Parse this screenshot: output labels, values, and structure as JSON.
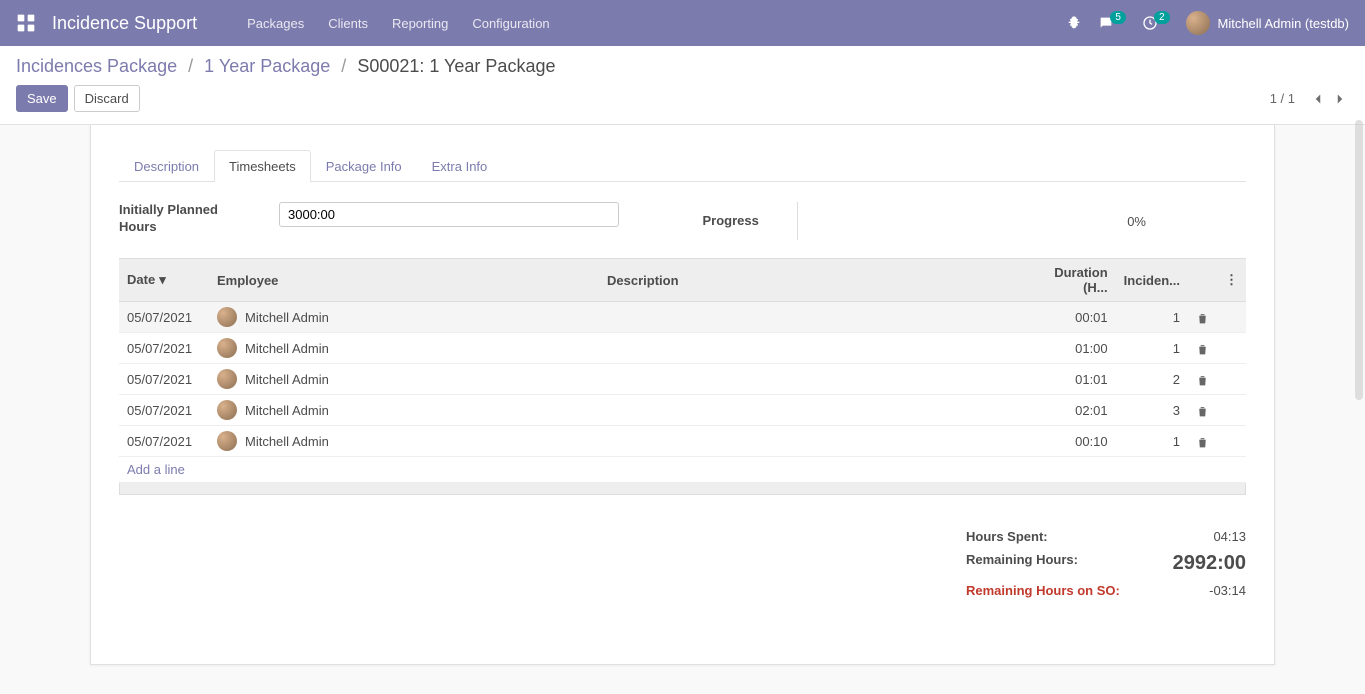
{
  "navbar": {
    "brand": "Incidence Support",
    "menu": [
      "Packages",
      "Clients",
      "Reporting",
      "Configuration"
    ],
    "messages_badge": "5",
    "activities_badge": "2",
    "user_name": "Mitchell Admin (testdb)"
  },
  "breadcrumb": {
    "items": [
      "Incidences Package",
      "1 Year Package"
    ],
    "current": "S00021: 1 Year Package"
  },
  "buttons": {
    "save": "Save",
    "discard": "Discard"
  },
  "pager": {
    "text": "1 / 1"
  },
  "tabs": [
    "Description",
    "Timesheets",
    "Package Info",
    "Extra Info"
  ],
  "active_tab": 1,
  "fields": {
    "planned_label": "Initially Planned Hours",
    "planned_value": "3000:00",
    "progress_label": "Progress",
    "progress_value": "0%"
  },
  "table": {
    "headers": {
      "date": "Date",
      "employee": "Employee",
      "description": "Description",
      "duration": "Duration (H...",
      "incidences": "Inciden..."
    },
    "rows": [
      {
        "date": "05/07/2021",
        "employee": "Mitchell Admin",
        "description": "",
        "duration": "00:01",
        "incidences": "1"
      },
      {
        "date": "05/07/2021",
        "employee": "Mitchell Admin",
        "description": "",
        "duration": "01:00",
        "incidences": "1"
      },
      {
        "date": "05/07/2021",
        "employee": "Mitchell Admin",
        "description": "",
        "duration": "01:01",
        "incidences": "2"
      },
      {
        "date": "05/07/2021",
        "employee": "Mitchell Admin",
        "description": "",
        "duration": "02:01",
        "incidences": "3"
      },
      {
        "date": "05/07/2021",
        "employee": "Mitchell Admin",
        "description": "",
        "duration": "00:10",
        "incidences": "1"
      }
    ],
    "add_line": "Add a line"
  },
  "summary": {
    "hours_spent_label": "Hours Spent:",
    "hours_spent_value": "04:13",
    "remaining_label": "Remaining Hours:",
    "remaining_value": "2992:00",
    "remaining_so_label": "Remaining Hours on SO:",
    "remaining_so_value": "-03:14"
  }
}
